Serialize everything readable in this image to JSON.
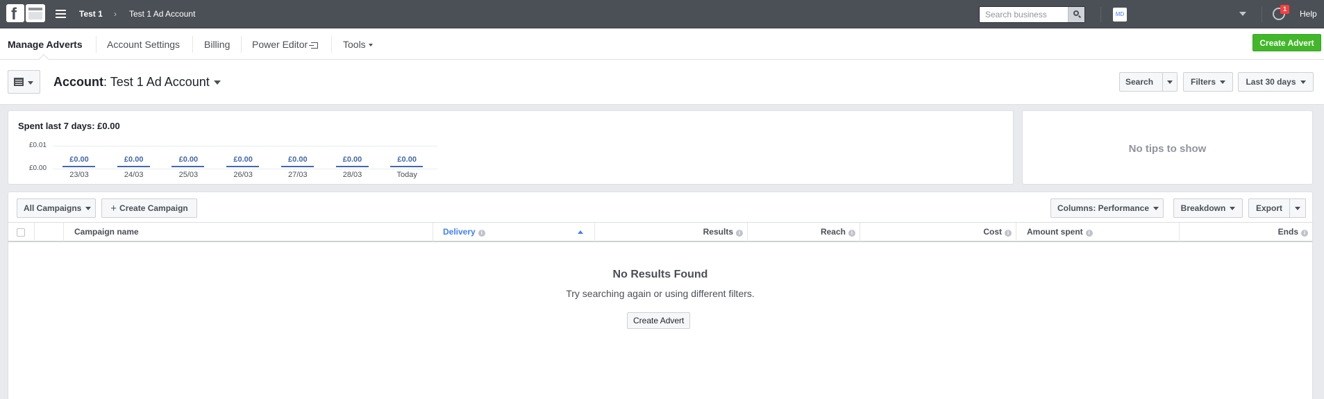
{
  "topbar": {
    "breadcrumb": [
      "Test 1",
      "Test 1 Ad Account"
    ],
    "search_placeholder": "Search business",
    "avatar_initials": "MD",
    "notification_count": "1",
    "help_label": "Help"
  },
  "nav": {
    "items": [
      {
        "label": "Manage Adverts",
        "active": true
      },
      {
        "label": "Account Settings"
      },
      {
        "label": "Billing"
      },
      {
        "label": "Power Editor"
      },
      {
        "label": "Tools"
      }
    ],
    "create_advert_label": "Create Advert"
  },
  "account_header": {
    "account_label": "Account",
    "account_name": "Test 1 Ad Account",
    "search_label": "Search",
    "filters_label": "Filters",
    "date_range_label": "Last 30 days"
  },
  "spend_card": {
    "title": "Spent last 7 days: £0.00",
    "chart_data": {
      "type": "bar",
      "title": "Spent last 7 days: £0.00",
      "categories": [
        "23/03",
        "24/03",
        "25/03",
        "26/03",
        "27/03",
        "28/03",
        "Today"
      ],
      "values": [
        0,
        0,
        0,
        0,
        0,
        0,
        0
      ],
      "value_labels": [
        "£0.00",
        "£0.00",
        "£0.00",
        "£0.00",
        "£0.00",
        "£0.00",
        "£0.00"
      ],
      "y_ticks": [
        "£0.01",
        "£0.00"
      ],
      "ylim": [
        0,
        0.01
      ]
    }
  },
  "tips_card": {
    "text": "No tips to show"
  },
  "campaigns": {
    "filter_label": "All Campaigns",
    "create_label": "Create Campaign",
    "columns_label": "Columns: Performance",
    "breakdown_label": "Breakdown",
    "export_label": "Export",
    "headers": [
      "Campaign name",
      "Delivery",
      "Results",
      "Reach",
      "Cost",
      "Amount spent",
      "Ends"
    ],
    "sorted_column": "Delivery",
    "empty_title": "No Results Found",
    "empty_subtitle": "Try searching again or using different filters.",
    "empty_button": "Create Advert"
  },
  "colors": {
    "topbar_bg": "#4b4f56",
    "primary_green": "#42b72a",
    "accent_blue": "#4267b2",
    "sort_blue": "#4080ff",
    "notification_red": "#fa3e3e"
  }
}
